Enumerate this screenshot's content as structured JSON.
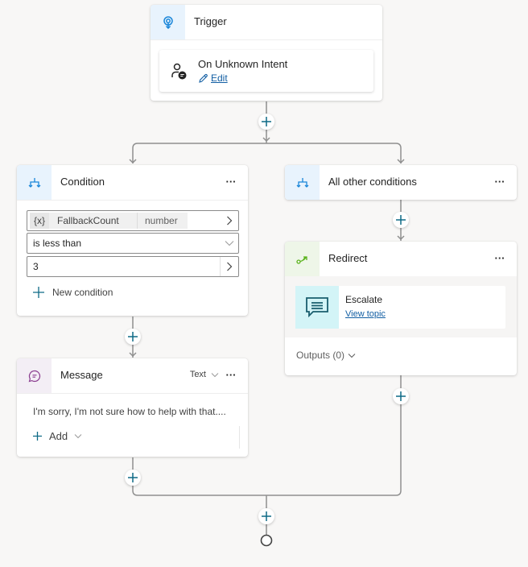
{
  "trigger": {
    "title": "Trigger",
    "icon": "trigger-pin-icon",
    "event_name": "On Unknown Intent",
    "event_icon": "person-chat-icon",
    "edit_label": "Edit",
    "edit_icon": "pencil-icon"
  },
  "condition": {
    "title": "Condition",
    "icon": "branch-icon",
    "variable_icon_label": "{x}",
    "variable_name": "FallbackCount",
    "variable_type": "number",
    "operator": "is less than",
    "value": "3",
    "new_condition_label": "New condition"
  },
  "other_conditions": {
    "title": "All other conditions",
    "icon": "branch-icon"
  },
  "redirect": {
    "title": "Redirect",
    "icon": "redirect-icon",
    "topic_name": "Escalate",
    "topic_icon": "chat-message-icon",
    "view_topic_label": "View topic",
    "outputs_label": "Outputs (0)"
  },
  "message": {
    "title": "Message",
    "icon": "message-icon",
    "type_label": "Text",
    "text": "I'm sorry, I'm not sure how to help with that....",
    "add_label": "Add"
  },
  "colors": {
    "accent": "#0f6cbd",
    "plus": "#0e6a86",
    "condition_icon_bg": "#e8f3fd",
    "redirect_icon_bg": "#eef6e8",
    "redirect_icon": "#5bb31d",
    "message_icon_bg": "#f3eef5",
    "message_icon": "#8a3c8f",
    "topic_bg": "#d3f4f7",
    "connector": "#8f8f8f"
  }
}
